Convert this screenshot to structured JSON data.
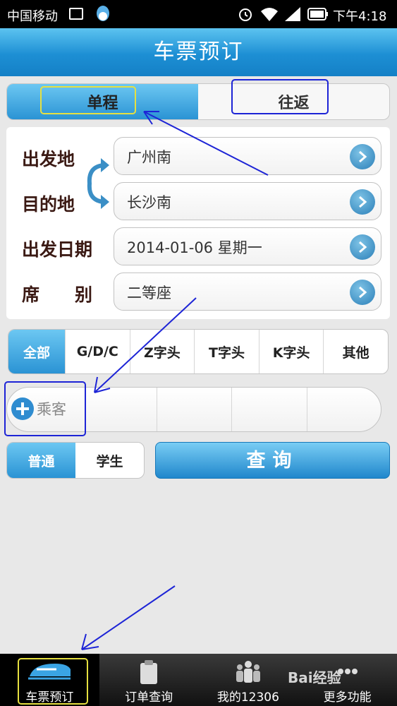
{
  "status_bar": {
    "carrier": "中国移动",
    "time": "下午4:18"
  },
  "header": {
    "title": "车票预订"
  },
  "trip_tabs": [
    {
      "label": "单程",
      "active": true
    },
    {
      "label": "往返",
      "active": false
    }
  ],
  "form": {
    "departure": {
      "label": "出发地",
      "value": "广州南"
    },
    "destination": {
      "label": "目的地",
      "value": "长沙南"
    },
    "date": {
      "label": "出发日期",
      "value": "2014-01-06 星期一"
    },
    "seat": {
      "label": "席　　别",
      "value": "二等座"
    }
  },
  "train_types": [
    "全部",
    "G/D/C",
    "Z字头",
    "T字头",
    "K字头",
    "其他"
  ],
  "passenger": {
    "add_label": "乘客"
  },
  "ticket_types": [
    {
      "label": "普通",
      "active": true
    },
    {
      "label": "学生",
      "active": false
    }
  ],
  "search_button": "查询",
  "bottom_nav": [
    {
      "label": "车票预订",
      "icon": "train-icon",
      "active": true
    },
    {
      "label": "订单查询",
      "icon": "clipboard-icon",
      "active": false
    },
    {
      "label": "我的12306",
      "icon": "people-icon",
      "active": false
    },
    {
      "label": "更多功能",
      "icon": "more-icon",
      "active": false
    }
  ],
  "watermark": "Bai经验",
  "colors": {
    "accent": "#2a93d4",
    "highlight_yellow": "#e6e040",
    "highlight_blue": "#1d24d6"
  }
}
